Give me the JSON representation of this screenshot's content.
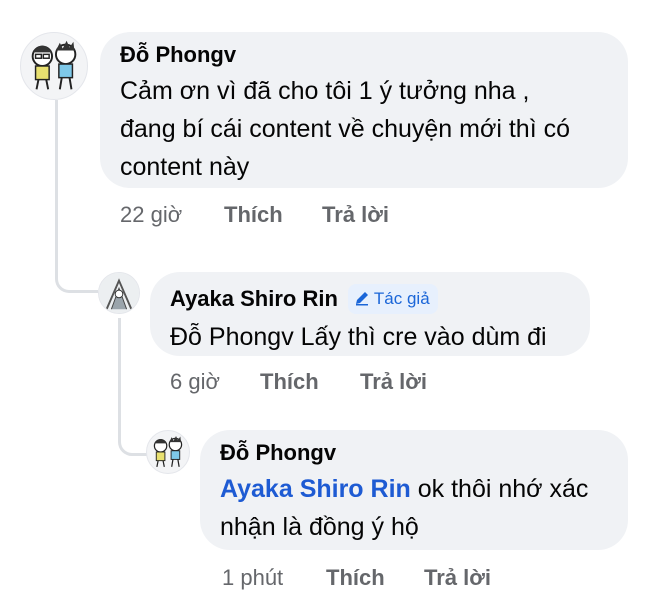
{
  "comments": [
    {
      "author": "Đỗ Phongv",
      "lines": [
        "Cảm ơn vì đã cho tôi 1 ý tưởng nha ,",
        "đang bí cái content về chuyện mới thì có",
        "content này"
      ],
      "time": "22 giờ",
      "like_label": "Thích",
      "reply_label": "Trả lời"
    },
    {
      "author": "Ayaka Shiro Rin",
      "badge": "Tác giả",
      "text": "Đỗ Phongv Lấy thì cre vào dùm đi",
      "time": "6 giờ",
      "like_label": "Thích",
      "reply_label": "Trả lời"
    },
    {
      "author": "Đỗ Phongv",
      "mention": "Ayaka Shiro Rin",
      "text_after_mention": " ok thôi nhớ xác",
      "line2": "nhận là đồng ý hộ",
      "time": "1 phút",
      "like_label": "Thích",
      "reply_label": "Trả lời"
    }
  ],
  "colors": {
    "bubble": "#f0f2f5",
    "mention": "#1e5bd3",
    "meta": "#65676b",
    "badge_bg": "#e7f0fd",
    "badge_text": "#1b66d8"
  },
  "icons": [
    "avatar-cartoon-pair",
    "avatar-sketch",
    "pencil-icon"
  ]
}
